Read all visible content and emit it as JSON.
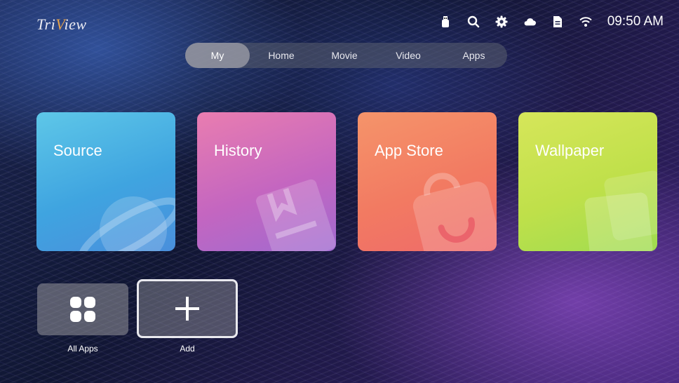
{
  "brand": {
    "logo_prefix": "Tri",
    "logo_v": "V",
    "logo_suffix": "iew"
  },
  "status_bar": {
    "icons": [
      "usb-icon",
      "search-icon",
      "gear-icon",
      "cloud-icon",
      "file-icon",
      "wifi-icon"
    ],
    "time": "09:50 AM"
  },
  "tabs": [
    {
      "label": "My",
      "active": true
    },
    {
      "label": "Home",
      "active": false
    },
    {
      "label": "Movie",
      "active": false
    },
    {
      "label": "Video",
      "active": false
    },
    {
      "label": "Apps",
      "active": false
    }
  ],
  "tiles": [
    {
      "label": "Source",
      "icon": "planet-icon",
      "color": "#4aaee4"
    },
    {
      "label": "History",
      "icon": "book-icon",
      "color": "#cb6fc0"
    },
    {
      "label": "App Store",
      "icon": "shopping-bag-icon",
      "color": "#f2805f"
    },
    {
      "label": "Wallpaper",
      "icon": "image-icon",
      "color": "#c4e04c"
    }
  ],
  "shortcuts": [
    {
      "label": "All Apps",
      "icon": "grid-icon"
    },
    {
      "label": "Add",
      "icon": "plus-icon"
    }
  ]
}
